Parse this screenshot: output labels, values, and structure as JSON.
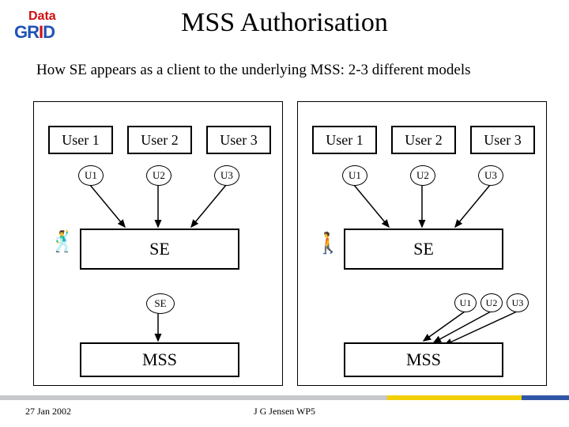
{
  "logo": {
    "top": "Data",
    "bottom": "GRID"
  },
  "title": "MSS Authorisation",
  "subtitle": "How SE appears as a client to the underlying MSS: 2-3 different models",
  "users": {
    "u1": "User 1",
    "u2": "User 2",
    "u3": "User 3"
  },
  "ids": {
    "u1": "U1",
    "u2": "U2",
    "u3": "U3"
  },
  "boxes": {
    "se": "SE",
    "mss": "MSS"
  },
  "footer": {
    "date": "27 Jan 2002",
    "center": "J G Jensen WP5"
  }
}
